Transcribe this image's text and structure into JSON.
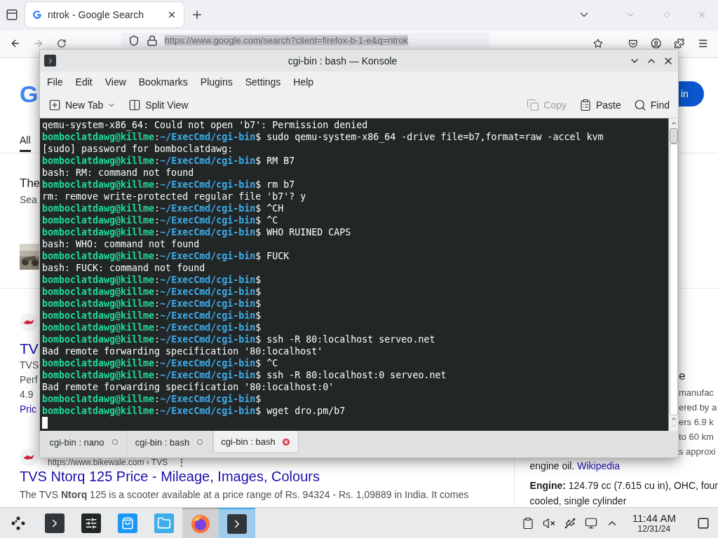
{
  "browser": {
    "tabs": [
      {
        "title": "ntrok - Google Search",
        "selected": true
      }
    ],
    "address": {
      "text": "https://www.google.com/search?client=firefox-b-1-e&q=ntrok",
      "selected": true
    },
    "page": {
      "logo_fragment": "G",
      "sign_in_fragment": "in",
      "search_tab": {
        "label": "All",
        "selected": true
      },
      "left_upper": [
        {
          "kind": "heading",
          "text": "The"
        },
        {
          "kind": "text",
          "text": "Sea"
        },
        {
          "kind": "picture"
        }
      ],
      "left_lower": [
        {
          "kind": "logo"
        },
        {
          "kind": "title",
          "text": "TV"
        },
        {
          "kind": "text",
          "text": "TVS"
        },
        {
          "kind": "text",
          "text": "Perf"
        },
        {
          "kind": "text",
          "text": "4.9"
        },
        {
          "kind": "link",
          "text": "Pric"
        }
      ],
      "right_fragments": [
        {
          "kind": "heading",
          "text": "e"
        },
        {
          "kind": "text",
          "text": "manufac"
        },
        {
          "kind": "text",
          "text": "ered by a"
        },
        {
          "kind": "text",
          "text": "ers 6.9 k"
        },
        {
          "kind": "text",
          "text": "to 60 km"
        },
        {
          "kind": "text",
          "text": "s approxi"
        }
      ],
      "result": {
        "url": "https://www.bikewale.com › TVS",
        "more": "⋮",
        "title": "TVS Ntorq 125 Price - Mileage, Images, Colours",
        "snippet": "The TVS **Ntorq** 125 is a scooter available at a price range of Rs. 94324 - Rs. 1,09889 in India. It comes"
      },
      "panel": {
        "source_text": "engine oil.",
        "source_link": "Wikipedia",
        "lines": [
          "**Engine:** 124.79 cc (7.615 cu in), OHC, four",
          "cooled, single cylinder"
        ]
      }
    }
  },
  "konsole": {
    "title": "cgi-bin : bash — Konsole",
    "menu": [
      "File",
      "Edit",
      "View",
      "Bookmarks",
      "Plugins",
      "Settings",
      "Help"
    ],
    "toolbar_left": [
      {
        "kind": "new-tab",
        "label": "New Tab",
        "disabled": false,
        "has_menu": true
      },
      {
        "kind": "split",
        "label": "Split View",
        "disabled": false,
        "has_menu": false
      }
    ],
    "toolbar_right": [
      {
        "kind": "copy",
        "label": "Copy",
        "disabled": true,
        "has_menu": false
      },
      {
        "kind": "paste",
        "label": "Paste",
        "disabled": false,
        "has_menu": false
      },
      {
        "kind": "find",
        "label": "Find",
        "disabled": false,
        "has_menu": false
      }
    ],
    "lines": [
      {
        "kind": "output",
        "text": "qemu-system-x86_64: Could not open 'b7': Permission denied"
      },
      {
        "kind": "prompt",
        "user": "bomboclatdawg@killme",
        "sep": ":",
        "path": "~/ExecCmd/cgi-bin",
        "symbol": "$",
        "command": "sudo qemu-system-x86_64 -drive file=b7,format=raw -accel kvm"
      },
      {
        "kind": "output",
        "text": "[sudo] password for bomboclatdawg:"
      },
      {
        "kind": "prompt",
        "user": "bomboclatdawg@killme",
        "sep": ":",
        "path": "~/ExecCmd/cgi-bin",
        "symbol": "$",
        "command": "RM B7"
      },
      {
        "kind": "output",
        "text": "bash: RM: command not found"
      },
      {
        "kind": "prompt",
        "user": "bomboclatdawg@killme",
        "sep": ":",
        "path": "~/ExecCmd/cgi-bin",
        "symbol": "$",
        "command": "rm b7"
      },
      {
        "kind": "output",
        "text": "rm: remove write-protected regular file 'b7'? y"
      },
      {
        "kind": "prompt",
        "user": "bomboclatdawg@killme",
        "sep": ":",
        "path": "~/ExecCmd/cgi-bin",
        "symbol": "$",
        "command": "^CH"
      },
      {
        "kind": "prompt",
        "user": "bomboclatdawg@killme",
        "sep": ":",
        "path": "~/ExecCmd/cgi-bin",
        "symbol": "$",
        "command": "^C"
      },
      {
        "kind": "prompt",
        "user": "bomboclatdawg@killme",
        "sep": ":",
        "path": "~/ExecCmd/cgi-bin",
        "symbol": "$",
        "command": "WHO RUINED CAPS"
      },
      {
        "kind": "output",
        "text": "bash: WHO: command not found"
      },
      {
        "kind": "prompt",
        "user": "bomboclatdawg@killme",
        "sep": ":",
        "path": "~/ExecCmd/cgi-bin",
        "symbol": "$",
        "command": "FUCK"
      },
      {
        "kind": "output",
        "text": "bash: FUCK: command not found"
      },
      {
        "kind": "prompt",
        "user": "bomboclatdawg@killme",
        "sep": ":",
        "path": "~/ExecCmd/cgi-bin",
        "symbol": "$"
      },
      {
        "kind": "prompt",
        "user": "bomboclatdawg@killme",
        "sep": ":",
        "path": "~/ExecCmd/cgi-bin",
        "symbol": "$"
      },
      {
        "kind": "prompt",
        "user": "bomboclatdawg@killme",
        "sep": ":",
        "path": "~/ExecCmd/cgi-bin",
        "symbol": "$"
      },
      {
        "kind": "prompt",
        "user": "bomboclatdawg@killme",
        "sep": ":",
        "path": "~/ExecCmd/cgi-bin",
        "symbol": "$"
      },
      {
        "kind": "prompt",
        "user": "bomboclatdawg@killme",
        "sep": ":",
        "path": "~/ExecCmd/cgi-bin",
        "symbol": "$"
      },
      {
        "kind": "prompt",
        "user": "bomboclatdawg@killme",
        "sep": ":",
        "path": "~/ExecCmd/cgi-bin",
        "symbol": "$",
        "command": "ssh -R 80:localhost serveo.net"
      },
      {
        "kind": "output",
        "text": "Bad remote forwarding specification '80:localhost'"
      },
      {
        "kind": "prompt",
        "user": "bomboclatdawg@killme",
        "sep": ":",
        "path": "~/ExecCmd/cgi-bin",
        "symbol": "$",
        "command": "^C"
      },
      {
        "kind": "prompt",
        "user": "bomboclatdawg@killme",
        "sep": ":",
        "path": "~/ExecCmd/cgi-bin",
        "symbol": "$",
        "command": "ssh -R 80:localhost:0 serveo.net"
      },
      {
        "kind": "output",
        "text": "Bad remote forwarding specification '80:localhost:0'"
      },
      {
        "kind": "prompt",
        "user": "bomboclatdawg@killme",
        "sep": ":",
        "path": "~/ExecCmd/cgi-bin",
        "symbol": "$"
      },
      {
        "kind": "prompt",
        "user": "bomboclatdawg@killme",
        "sep": ":",
        "path": "~/ExecCmd/cgi-bin",
        "symbol": "$",
        "command": "wget dro.pm/b7"
      },
      {
        "kind": "cursor"
      }
    ],
    "tabs": [
      {
        "title": "cgi-bin : nano",
        "selected": false
      },
      {
        "title": "cgi-bin : bash",
        "selected": false
      },
      {
        "title": "cgi-bin : bash",
        "selected": true
      }
    ]
  },
  "taskbar": {
    "apps": [
      {
        "kind": "launcher",
        "open": false,
        "selected": false
      },
      {
        "kind": "terminal",
        "open": false,
        "selected": false
      },
      {
        "kind": "settings",
        "open": false,
        "selected": false
      },
      {
        "kind": "store",
        "open": false,
        "selected": false
      },
      {
        "kind": "files",
        "open": false,
        "selected": false
      },
      {
        "kind": "browser",
        "open": true,
        "selected": false
      },
      {
        "kind": "terminal",
        "open": true,
        "selected": true
      }
    ],
    "tray": [
      {
        "kind": "clipboard"
      },
      {
        "kind": "muted"
      },
      {
        "kind": "usb"
      },
      {
        "kind": "network"
      },
      {
        "kind": "expand"
      }
    ],
    "time": "11:44 AM",
    "date": "12/31/24"
  }
}
